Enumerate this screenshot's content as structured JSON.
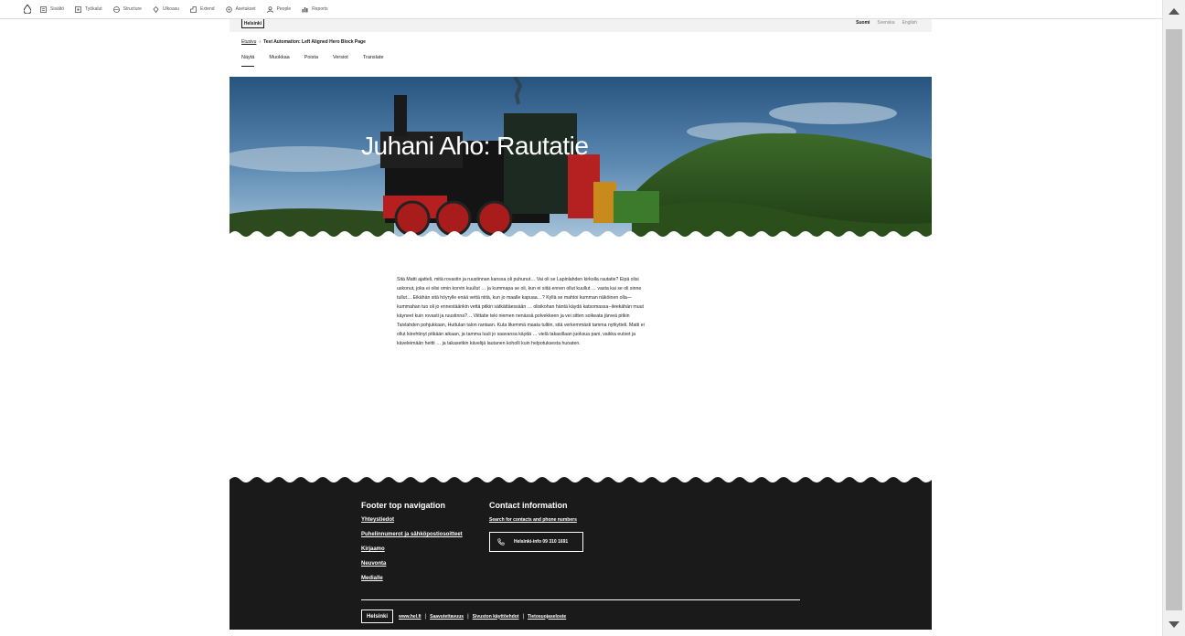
{
  "toolbar": {
    "items": [
      {
        "label": "Sisältö",
        "icon": "content-icon"
      },
      {
        "label": "Työkalut",
        "icon": "tools-icon"
      },
      {
        "label": "Structure",
        "icon": "structure-icon"
      },
      {
        "label": "Ulkoasu",
        "icon": "appearance-icon"
      },
      {
        "label": "Extend",
        "icon": "extend-icon"
      },
      {
        "label": "Asetukset",
        "icon": "settings-icon"
      },
      {
        "label": "People",
        "icon": "people-icon"
      },
      {
        "label": "Reports",
        "icon": "reports-icon"
      }
    ]
  },
  "header": {
    "logo": "Helsinki",
    "languages": [
      "Suomi",
      "Svenska",
      "English"
    ],
    "active_language": "Suomi"
  },
  "breadcrumb": {
    "home": "Etusivu",
    "separator": "›",
    "current": "Test Automation: Left Aligned Hero Block Page"
  },
  "tabs": [
    "Näytä",
    "Muokkaa",
    "Poista",
    "Versiot",
    "Translate"
  ],
  "hero": {
    "title": "Juhani Aho: Rautatie"
  },
  "body_text": "Sitä Matti ajatteli, mitä rovastin ja ruustinnan kanssa oli puhunut… Vai oli se Lapinlahden kirkolla rautatie? Eipä olisi uskonut, joka ei olisi omin korvin kuullut … ja kummapa se oli, kun ei siitä ennen ollut kuullut … vasta kai se oli sinne tullut… Eikähän sitä höyrylle enää vettä niitä, kun jo maalle kapuaa…? Kyllä se mahtoi kumman näköinen olla—kummahan tuo oli jo ennestäänkin vettä pitkin sätkättäessään … olisikohan häntä käydä katsomassa--ileekähän muut käyneet kuin rovasti ja ruustinna?… Viittatie teki niemen nenässä polvekkeen ja vei sitten soikeata järveä pitkin Taivlahden pohjukkaan, Huttulan talon rantaan. Kuta likemmä maata tultiin, sitä verkemmästi tamma nytkytteli. Matti ei ollut kiirehtinyt pitkään aikaan, ja tamma luuli jo saavansa käydä … vielä takasillaan juoksua pani, vaikka eutset ja käveleimään heitti … ja takasetkin kävelijä lautanen koholli kuin helpotuksesta huoaten.",
  "footer": {
    "nav_title": "Footer top navigation",
    "nav_links": [
      "Yhteystiedot",
      "Puhelinnumerot ja sähköpostiosoitteet",
      "Kirjaamo",
      "Neuvonta",
      "Medialle"
    ],
    "contact_title": "Contact information",
    "contact_link": "Search for contacts and phone numbers",
    "phone_label": "Helsinki-info 09 310 1691",
    "logo": "Helsinki",
    "bottom_links": [
      "www.hel.fi",
      "Saavutettavuus",
      "Sivuston käyttöehdot",
      "Tietosuojaseloste"
    ]
  },
  "colors": {
    "footer_bg": "#1a1a1a",
    "toolbar_bg": "#ffffff",
    "scrollbar_thumb": "#c1c1c1"
  }
}
